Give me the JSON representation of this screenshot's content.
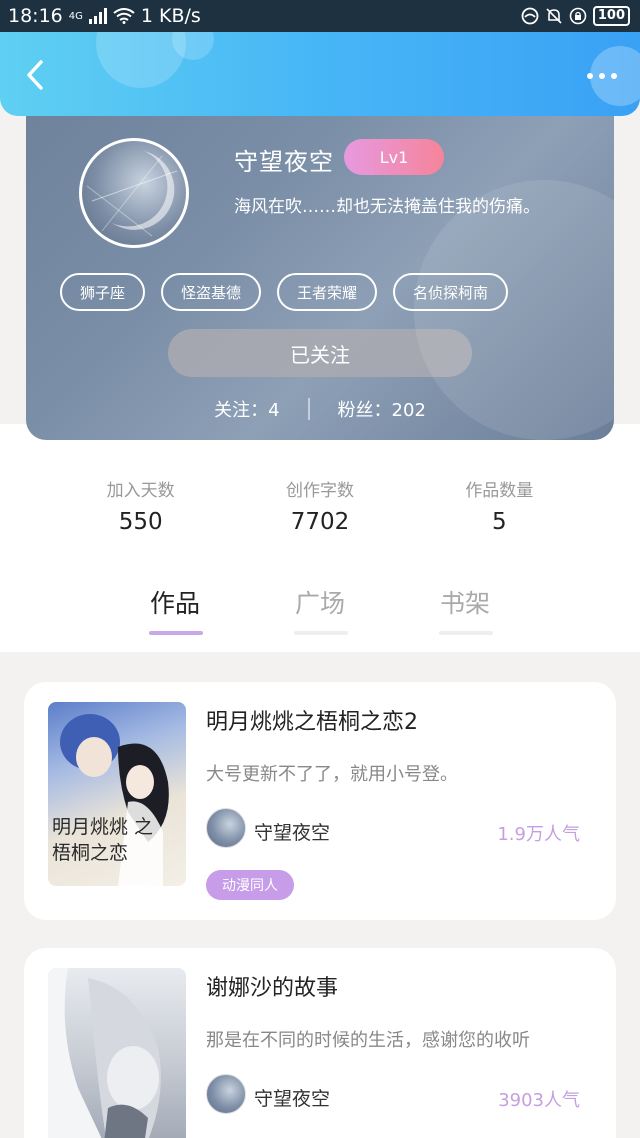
{
  "status_bar": {
    "time": "18:16",
    "network": "4G",
    "speed": "1 KB/s",
    "battery": "100"
  },
  "header": {
    "back_icon": "chevron-left-icon",
    "more_icon": "more-dots-icon"
  },
  "profile": {
    "username": "守望夜空",
    "level": "Lv1",
    "signature": "海风在吹……却也无法掩盖住我的伤痛。",
    "tags": [
      "狮子座",
      "怪盗基德",
      "王者荣耀",
      "名侦探柯南"
    ],
    "follow_button": "已关注",
    "following_text": "关注：4",
    "followers_text": "粉丝：202"
  },
  "stats": [
    {
      "label": "加入天数",
      "value": "550"
    },
    {
      "label": "创作字数",
      "value": "7702"
    },
    {
      "label": "作品数量",
      "value": "5"
    }
  ],
  "tabs": [
    {
      "label": "作品",
      "active": true
    },
    {
      "label": "广场",
      "active": false
    },
    {
      "label": "书架",
      "active": false
    }
  ],
  "works": [
    {
      "title": "明月烑烑之梧桐之恋2",
      "description": "大号更新不了了，就用小号登。",
      "author": "守望夜空",
      "popularity": "1.9万人气",
      "genre": "动漫同人",
      "cover_text": "明月烑烑 之梧桐之恋"
    },
    {
      "title": "谢娜沙的故事",
      "description": "那是在不同的时候的生活，感谢您的收听",
      "author": "守望夜空",
      "popularity": "3903人气",
      "genre": ""
    }
  ],
  "colors": {
    "header_start": "#5fd0f2",
    "header_end": "#3aa1f5",
    "level_badge": "#f5849a",
    "tab_active_underline": "#c8a8e9",
    "popularity": "#c59fe0",
    "genre_tag": "#c79ce9"
  }
}
